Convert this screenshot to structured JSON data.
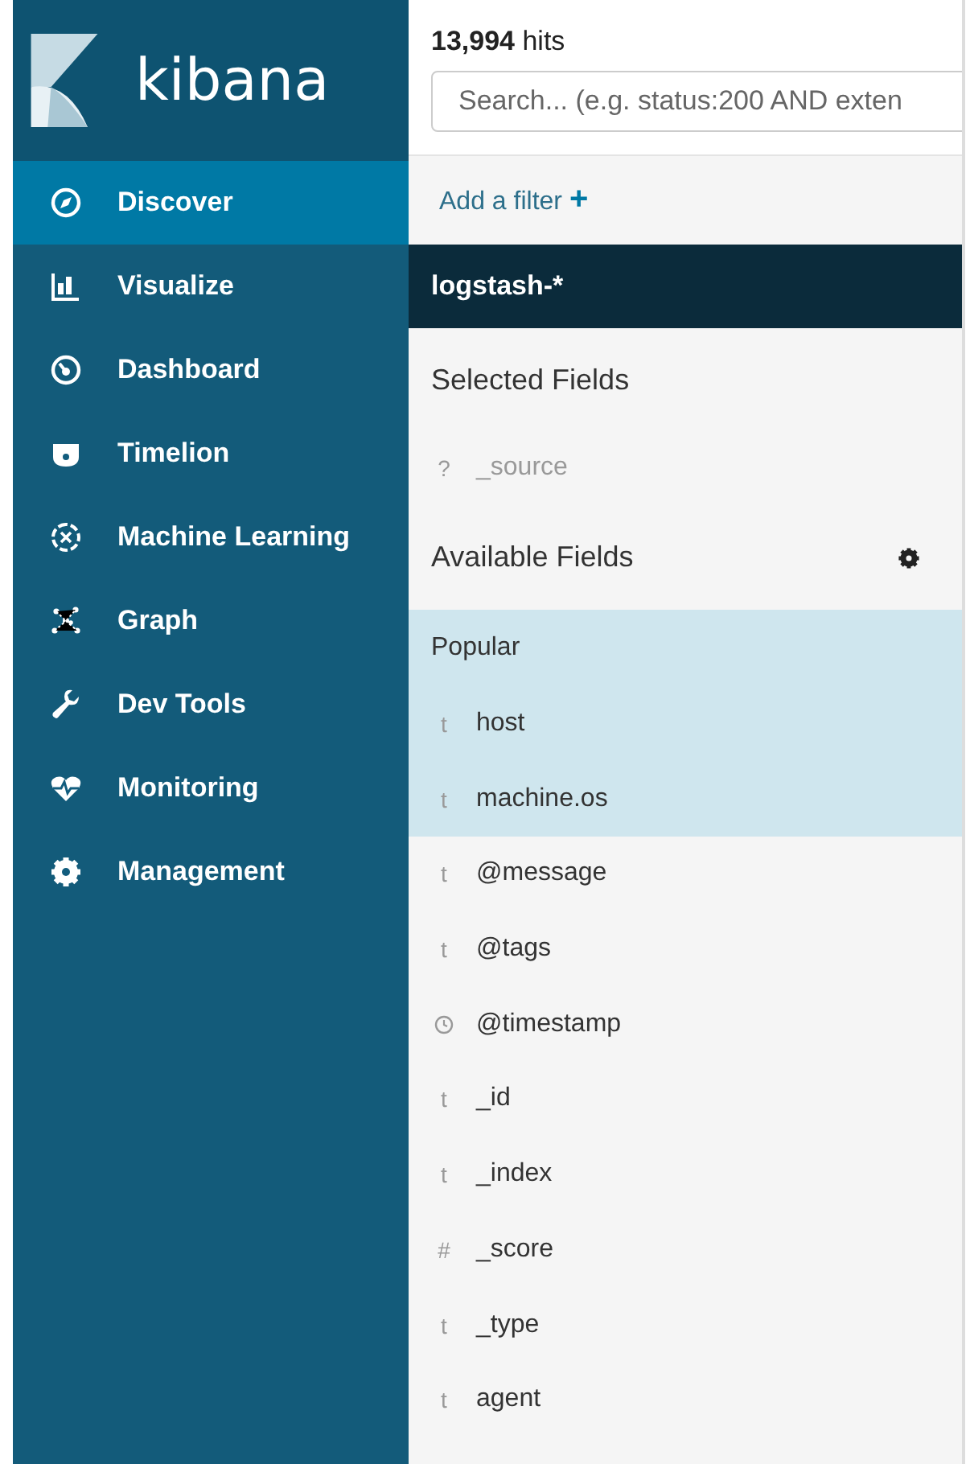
{
  "sidebar": {
    "logo_text": "kibana",
    "items": [
      {
        "label": "Discover",
        "selected": true
      },
      {
        "label": "Visualize",
        "selected": false
      },
      {
        "label": "Dashboard",
        "selected": false
      },
      {
        "label": "Timelion",
        "selected": false
      },
      {
        "label": "Machine Learning",
        "selected": false
      },
      {
        "label": "Graph",
        "selected": false
      },
      {
        "label": "Dev Tools",
        "selected": false
      },
      {
        "label": "Monitoring",
        "selected": false
      },
      {
        "label": "Management",
        "selected": false
      }
    ]
  },
  "hits": "**13,994** hits",
  "search": {
    "placeholder": "Search... (e.g. status:200 AND exten"
  },
  "add_filter": {
    "label": "Add a filter",
    "glyph": "+"
  },
  "index_pattern": "logstash-*",
  "selected_fields": {
    "title": "Selected Fields",
    "fields": [
      {
        "kind": "text",
        "glyph": "?",
        "name": "_source"
      }
    ]
  },
  "available_fields": {
    "title": "Available Fields",
    "popular": {
      "label": "Popular",
      "fields": [
        {
          "kind": "text",
          "glyph": "t",
          "name": "host"
        },
        {
          "kind": "text",
          "glyph": "t",
          "name": "machine.os"
        }
      ]
    },
    "fields": [
      {
        "kind": "text",
        "glyph": "t",
        "name": "@message"
      },
      {
        "kind": "text",
        "glyph": "t",
        "name": "@tags"
      },
      {
        "kind": "date",
        "name": "@timestamp"
      },
      {
        "kind": "text",
        "glyph": "t",
        "name": "_id"
      },
      {
        "kind": "text",
        "glyph": "t",
        "name": "_index"
      },
      {
        "kind": "text",
        "glyph": "#",
        "name": "_score"
      },
      {
        "kind": "text",
        "glyph": "t",
        "name": "_type"
      },
      {
        "kind": "text",
        "glyph": "t",
        "name": "agent"
      }
    ]
  }
}
